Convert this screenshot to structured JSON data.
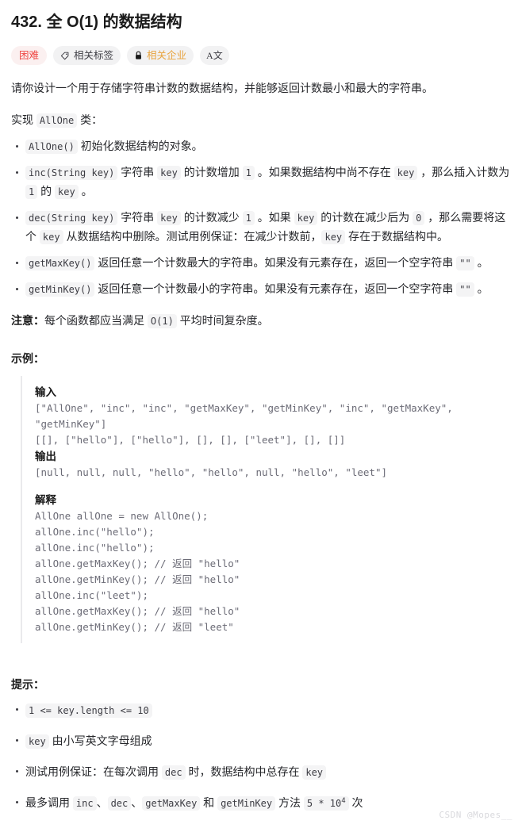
{
  "problem": {
    "title": "432. 全 O(1) 的数据结构"
  },
  "badges": {
    "difficulty": {
      "label": "困难",
      "color": "#ef4743"
    },
    "tags": {
      "label": "相关标签",
      "icon": "tag-icon"
    },
    "company": {
      "label": "相关企业",
      "icon": "lock-icon",
      "color": "#e8a33d"
    },
    "fontsize": {
      "label": "A文",
      "icon": "font-size-icon"
    }
  },
  "description": {
    "intro": "请你设计一个用于存储字符串计数的数据结构，并能够返回计数最小和最大的字符串。",
    "implement_prefix": "实现 ",
    "implement_code": "AllOne",
    "implement_suffix": " 类：",
    "methods": [
      {
        "parts": [
          {
            "type": "code",
            "text": "AllOne()"
          },
          {
            "type": "text",
            "text": " 初始化数据结构的对象。"
          }
        ]
      },
      {
        "parts": [
          {
            "type": "code",
            "text": "inc(String key)"
          },
          {
            "type": "text",
            "text": " 字符串 "
          },
          {
            "type": "code",
            "text": "key"
          },
          {
            "type": "text",
            "text": " 的计数增加 "
          },
          {
            "type": "code",
            "text": "1"
          },
          {
            "type": "text",
            "text": " 。如果数据结构中尚不存在 "
          },
          {
            "type": "code",
            "text": "key"
          },
          {
            "type": "text",
            "text": " ，那么插入计数为 "
          },
          {
            "type": "code",
            "text": "1"
          },
          {
            "type": "text",
            "text": " 的 "
          },
          {
            "type": "code",
            "text": "key"
          },
          {
            "type": "text",
            "text": " 。"
          }
        ]
      },
      {
        "parts": [
          {
            "type": "code",
            "text": "dec(String key)"
          },
          {
            "type": "text",
            "text": " 字符串 "
          },
          {
            "type": "code",
            "text": "key"
          },
          {
            "type": "text",
            "text": " 的计数减少 "
          },
          {
            "type": "code",
            "text": "1"
          },
          {
            "type": "text",
            "text": " 。如果 "
          },
          {
            "type": "code",
            "text": "key"
          },
          {
            "type": "text",
            "text": " 的计数在减少后为 "
          },
          {
            "type": "code",
            "text": "0"
          },
          {
            "type": "text",
            "text": " ，那么需要将这个 "
          },
          {
            "type": "code",
            "text": "key"
          },
          {
            "type": "text",
            "text": " 从数据结构中删除。测试用例保证：在减少计数前，"
          },
          {
            "type": "code",
            "text": "key"
          },
          {
            "type": "text",
            "text": " 存在于数据结构中。"
          }
        ]
      },
      {
        "parts": [
          {
            "type": "code",
            "text": "getMaxKey()"
          },
          {
            "type": "text",
            "text": " 返回任意一个计数最大的字符串。如果没有元素存在，返回一个空字符串 "
          },
          {
            "type": "code",
            "text": "\"\""
          },
          {
            "type": "text",
            "text": " 。"
          }
        ]
      },
      {
        "parts": [
          {
            "type": "code",
            "text": "getMinKey()"
          },
          {
            "type": "text",
            "text": " 返回任意一个计数最小的字符串。如果没有元素存在，返回一个空字符串 "
          },
          {
            "type": "code",
            "text": "\"\""
          },
          {
            "type": "text",
            "text": " 。"
          }
        ]
      }
    ],
    "note": {
      "label": "注意：",
      "parts": [
        {
          "type": "text",
          "text": "每个函数都应当满足 "
        },
        {
          "type": "code",
          "text": "O(1)"
        },
        {
          "type": "text",
          "text": " 平均时间复杂度。"
        }
      ]
    }
  },
  "example": {
    "heading": "示例：",
    "input_label": "输入",
    "input_lines": [
      "[\"AllOne\", \"inc\", \"inc\", \"getMaxKey\", \"getMinKey\", \"inc\", \"getMaxKey\", \"getMinKey\"]",
      "[[], [\"hello\"], [\"hello\"], [], [], [\"leet\"], [], []]"
    ],
    "output_label": "输出",
    "output_lines": [
      "[null, null, null, \"hello\", \"hello\", null, \"hello\", \"leet\"]"
    ],
    "explain_label": "解释",
    "explain_lines": [
      "AllOne allOne = new AllOne();",
      "allOne.inc(\"hello\");",
      "allOne.inc(\"hello\");",
      "allOne.getMaxKey(); // 返回 \"hello\"",
      "allOne.getMinKey(); // 返回 \"hello\"",
      "allOne.inc(\"leet\");",
      "allOne.getMaxKey(); // 返回 \"hello\"",
      "allOne.getMinKey(); // 返回 \"leet\""
    ]
  },
  "hints": {
    "heading": "提示：",
    "items": [
      {
        "parts": [
          {
            "type": "code",
            "text": "1 <= key.length <= 10"
          }
        ]
      },
      {
        "parts": [
          {
            "type": "code",
            "text": "key"
          },
          {
            "type": "text",
            "text": " 由小写英文字母组成"
          }
        ]
      },
      {
        "parts": [
          {
            "type": "text",
            "text": "测试用例保证：在每次调用 "
          },
          {
            "type": "code",
            "text": "dec"
          },
          {
            "type": "text",
            "text": " 时，数据结构中总存在 "
          },
          {
            "type": "code",
            "text": "key"
          }
        ]
      },
      {
        "parts": [
          {
            "type": "text",
            "text": "最多调用 "
          },
          {
            "type": "code",
            "text": "inc"
          },
          {
            "type": "text",
            "text": "、"
          },
          {
            "type": "code",
            "text": "dec"
          },
          {
            "type": "text",
            "text": "、"
          },
          {
            "type": "code",
            "text": "getMaxKey"
          },
          {
            "type": "text",
            "text": " 和 "
          },
          {
            "type": "code",
            "text": "getMinKey"
          },
          {
            "type": "text",
            "text": " 方法 "
          },
          {
            "type": "code",
            "text": "5 * 10",
            "sup": "4"
          },
          {
            "type": "text",
            "text": " 次"
          }
        ]
      }
    ]
  },
  "watermark": "CSDN @Mopes__"
}
